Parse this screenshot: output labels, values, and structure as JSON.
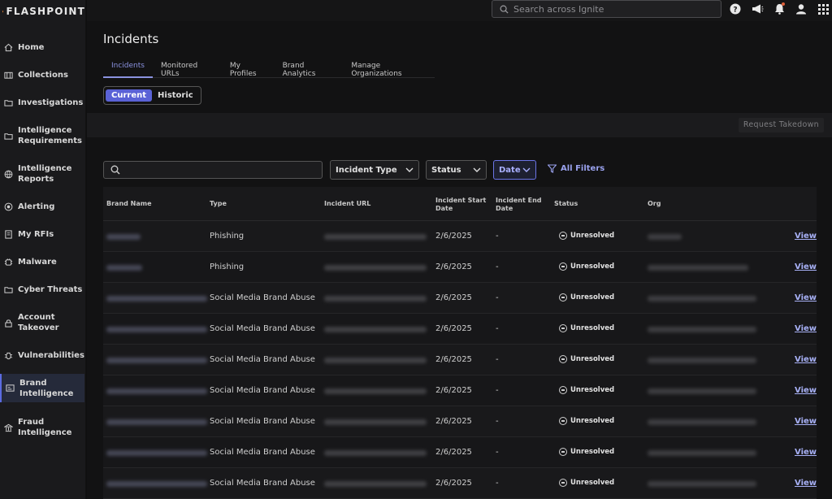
{
  "brand": {
    "name": "FLASHPOINT"
  },
  "sidebar": {
    "items": [
      {
        "label": "Home",
        "icon": "home-icon"
      },
      {
        "label": "Collections",
        "icon": "collections-icon"
      },
      {
        "label": "Investigations",
        "icon": "folder-icon"
      },
      {
        "label": "Intelligence Requirements",
        "icon": "folder-icon"
      },
      {
        "label": "Intelligence Reports",
        "icon": "globe-icon"
      },
      {
        "label": "Alerting",
        "icon": "alert-icon"
      },
      {
        "label": "My RFIs",
        "icon": "rfi-icon"
      },
      {
        "label": "Malware",
        "icon": "malware-icon"
      },
      {
        "label": "Cyber Threats",
        "icon": "folder-icon"
      },
      {
        "label": "Account Takeover",
        "icon": "lock-icon"
      },
      {
        "label": "Vulnerabilities",
        "icon": "bug-icon"
      },
      {
        "label": "Brand Intelligence",
        "icon": "brand-icon",
        "active": true
      },
      {
        "label": "Fraud Intelligence",
        "icon": "bank-icon"
      }
    ]
  },
  "topbar": {
    "search_placeholder": "Search across Ignite",
    "icons": [
      "help-icon",
      "megaphone-icon",
      "bell-icon",
      "user-icon",
      "apps-grid-icon"
    ]
  },
  "page": {
    "title": "Incidents",
    "tabs": [
      "Incidents",
      "Monitored URLs",
      "My Profiles",
      "Brand Analytics",
      "Manage Organizations"
    ],
    "toggle": {
      "current": "Current",
      "historic": "Historic"
    },
    "request_takedown": "Request Takedown"
  },
  "filters": {
    "incident_type": "Incident Type",
    "status": "Status",
    "date": "Date",
    "all_filters": "All Filters"
  },
  "table": {
    "headers": {
      "brand_name": "Brand Name",
      "type": "Type",
      "incident_url": "Incident URL",
      "start_date": "Incident Start Date",
      "end_date": "Incident End Date",
      "status": "Status",
      "org": "Org"
    },
    "rows": [
      {
        "type": "Phishing",
        "start": "2/6/2025",
        "end": "-",
        "status": "Unresolved",
        "action": "View"
      },
      {
        "type": "Phishing",
        "start": "2/6/2025",
        "end": "-",
        "status": "Unresolved",
        "action": "View"
      },
      {
        "type": "Social Media Brand Abuse",
        "start": "2/6/2025",
        "end": "-",
        "status": "Unresolved",
        "action": "View"
      },
      {
        "type": "Social Media Brand Abuse",
        "start": "2/6/2025",
        "end": "-",
        "status": "Unresolved",
        "action": "View"
      },
      {
        "type": "Social Media Brand Abuse",
        "start": "2/6/2025",
        "end": "-",
        "status": "Unresolved",
        "action": "View"
      },
      {
        "type": "Social Media Brand Abuse",
        "start": "2/6/2025",
        "end": "-",
        "status": "Unresolved",
        "action": "View"
      },
      {
        "type": "Social Media Brand Abuse",
        "start": "2/6/2025",
        "end": "-",
        "status": "Unresolved",
        "action": "View"
      },
      {
        "type": "Social Media Brand Abuse",
        "start": "2/6/2025",
        "end": "-",
        "status": "Unresolved",
        "action": "View"
      },
      {
        "type": "Social Media Brand Abuse",
        "start": "2/6/2025",
        "end": "-",
        "status": "Unresolved",
        "action": "View"
      }
    ]
  },
  "colors": {
    "accent": "#5a62d6",
    "link": "#a7b0f5",
    "background": "#121213",
    "sidebar": "#1a1a1c"
  }
}
